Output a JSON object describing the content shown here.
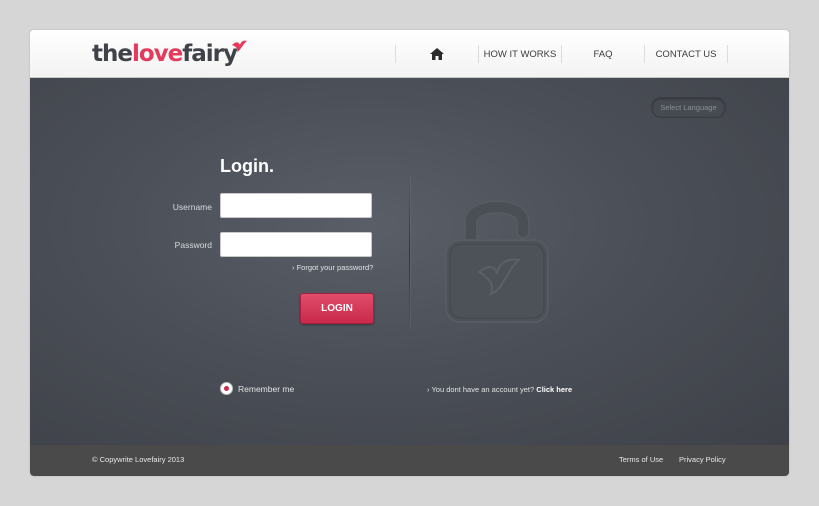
{
  "brand": {
    "logo_the": "the",
    "logo_love": "love",
    "logo_fairy": "fairy",
    "accent_color": "#e43a5c"
  },
  "nav": {
    "home_icon": "home-icon",
    "items": [
      "HOW IT WORKS",
      "FAQ",
      "CONTACT US"
    ]
  },
  "language": {
    "label": "Select Language"
  },
  "login": {
    "title": "Login.",
    "username_label": "Username",
    "username_value": "",
    "password_label": "Password",
    "password_value": "",
    "forgot_text": "Forgot your password?",
    "button_label": "LOGIN",
    "remember_label": "Remember me",
    "remember_checked": true
  },
  "signup": {
    "prompt": "You dont have an account yet?",
    "link": "Click here"
  },
  "footer": {
    "copyright": "Copywrite Lovefairy 2013",
    "terms": "Terms of Use",
    "privacy": "Privacy Policy"
  }
}
